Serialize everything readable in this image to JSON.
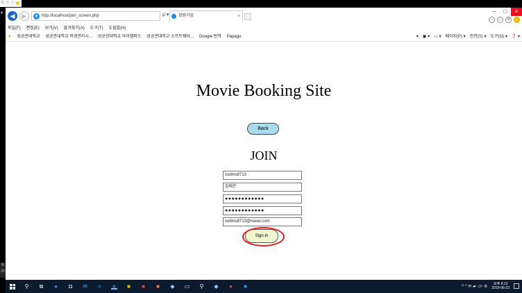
{
  "overlay": {
    "thumb_text": "파 은 ☆",
    "taskbar_peek": [
      "트",
      "20"
    ]
  },
  "browser": {
    "url": "http://localhost/join_screen.php",
    "address_tools": "ρ ▾ ♂",
    "tab_title": "회원가입",
    "window_controls": {
      "minimize": "–",
      "maximize": "□",
      "close": "×"
    },
    "right_icons": [
      "⌂",
      "☆",
      "⚙"
    ]
  },
  "menu": {
    "items": [
      "파일(F)",
      "편집(E)",
      "보기(V)",
      "즐겨찾기(A)",
      "도구(T)",
      "도움말(H)"
    ]
  },
  "favorites": {
    "items": [
      "성균관대학교",
      "성균관대학교 학생관리시...",
      "성균관대학교 아이캠퍼스",
      "성균관대학교 소프트웨어...",
      "Google 번역",
      "Papago"
    ],
    "commands": [
      "▾",
      "▣ ▾",
      "▭ ▾",
      "페이지(P) ▾",
      "안전(S) ▾",
      "도구(O) ▾",
      "❓ ▾"
    ]
  },
  "page": {
    "title": "Movie Booking Site",
    "back_button": "Back",
    "join_heading": "JOIN",
    "fields": {
      "user_id": "xodms8713",
      "name": "김태은",
      "password": "●●●●●●●●●●●●",
      "password_confirm": "●●●●●●●●●●●●",
      "email": "xodms8713@naver.com"
    },
    "signin_button": "Sign In"
  },
  "taskbar": {
    "tray_text": "ᴿ  ^  ✉  ▰  ◁×  ⚙",
    "time": "오후 8:12",
    "date": "2019-06-23"
  },
  "colors": {
    "back_pill": "#a9dcec",
    "signin_fill": "#f0f6cf",
    "highlight_ring": "#e01818",
    "taskbar": "#0c1a2e"
  }
}
